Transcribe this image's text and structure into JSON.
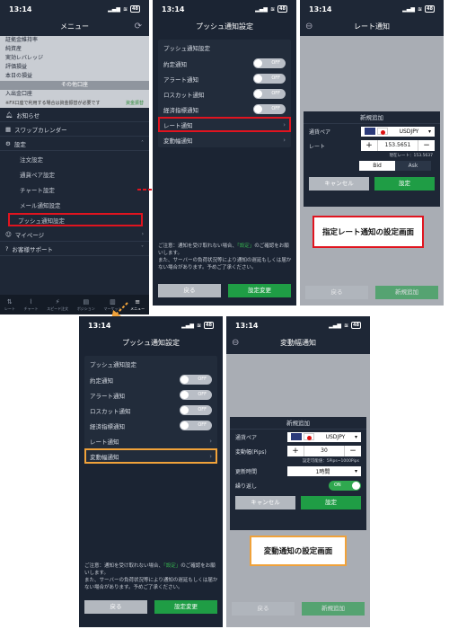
{
  "colors": {
    "red": "#e0141f",
    "orange": "#f0a23a",
    "green": "#1f9d45",
    "dark": "#1e2736"
  },
  "status": {
    "time": "13:14",
    "battery": "48"
  },
  "screen1": {
    "title": "メニュー",
    "info_rows": [
      "証拠金維持率",
      "純資産",
      "実効レバレッジ",
      "評価損益",
      "本日の損益"
    ],
    "section_title": "その他口座",
    "deposit_label": "入出金口座",
    "note": "※FX口座で利用する場合は資金振替が必要です",
    "note_link": "資金振替",
    "items": [
      {
        "label": "お知らせ",
        "icon": "bell-icon"
      },
      {
        "label": "スワップカレンダー",
        "icon": "calendar-icon"
      },
      {
        "label": "設定",
        "icon": "gear-icon"
      }
    ],
    "subitems": [
      "注文設定",
      "通貨ペア設定",
      "チャート設定",
      "メール通知設定",
      "プッシュ通知設定"
    ],
    "items2": [
      {
        "label": "マイページ",
        "icon": "person-icon"
      },
      {
        "label": "お客様サポート",
        "icon": "help-icon"
      }
    ],
    "tabs": [
      "レート",
      "チャート",
      "スピード注文",
      "ポジション",
      "マーケット",
      "メニュー"
    ]
  },
  "push_settings": {
    "title": "プッシュ通知設定",
    "section": "プッシュ通知設定",
    "rows": [
      {
        "label": "約定通知",
        "state": "OFF"
      },
      {
        "label": "アラート通知",
        "state": "OFF"
      },
      {
        "label": "ロスカット通知",
        "state": "OFF"
      },
      {
        "label": "経済指標通知",
        "state": "OFF"
      }
    ],
    "link_rate": "レート通知",
    "link_change": "変動幅通知",
    "notice1": "ご注意：通知を受け取れない場合、",
    "notice_link": "「設定」",
    "notice2": "のご確認をお願いします。",
    "notice3": "また、サーバーの負荷状況等により通知の遅延もしくは届かない場合があります。予めご了承ください。",
    "back": "戻る",
    "save": "設定変更"
  },
  "rate_alert": {
    "title": "レート通知",
    "modal_title": "新規追加",
    "pair_label": "通貨ペア",
    "pair": "USDJPY",
    "rate_label": "レート",
    "rate_value": "153.5651",
    "current_rate": "現在レート：153.5637",
    "bid": "Bid",
    "ask": "Ask",
    "cancel": "キャンセル",
    "set": "設定",
    "back": "戻る",
    "add_new": "新規追加",
    "callout": "指定レート通知の設定画面"
  },
  "change_alert": {
    "title": "変動幅通知",
    "modal_title": "新規追加",
    "pair_label": "通貨ペア",
    "pair": "USDJPY",
    "width_label": "変動幅(Pips)",
    "width_value": "30",
    "range_note": "設定可能値：5Pips~1000Pips",
    "interval_label": "更新時間",
    "interval": "1時間",
    "repeat_label": "繰り返し",
    "repeat_state": "ON",
    "cancel": "キャンセル",
    "set": "設定",
    "back": "戻る",
    "add_new": "新規追加",
    "callout": "変動通知の設定画面"
  }
}
